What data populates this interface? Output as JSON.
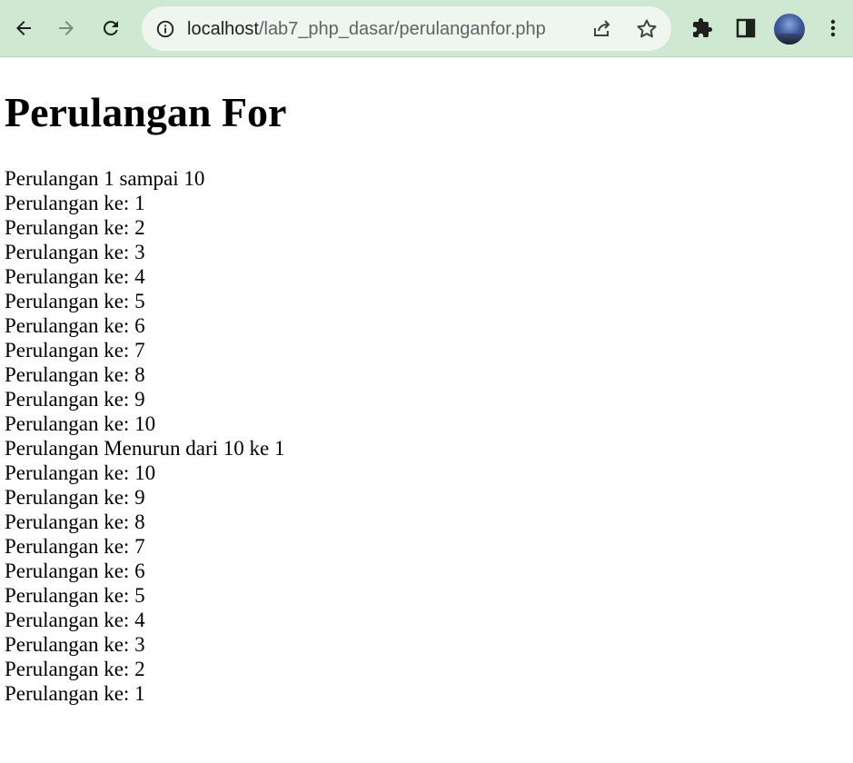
{
  "browser": {
    "url_host": "localhost",
    "url_path": "/lab7_php_dasar/perulanganfor.php",
    "theme_color": "#cfe8d1"
  },
  "page": {
    "title": "Perulangan For",
    "lines": [
      "Perulangan 1 sampai 10",
      "Perulangan ke: 1",
      "Perulangan ke: 2",
      "Perulangan ke: 3",
      "Perulangan ke: 4",
      "Perulangan ke: 5",
      "Perulangan ke: 6",
      "Perulangan ke: 7",
      "Perulangan ke: 8",
      "Perulangan ke: 9",
      "Perulangan ke: 10",
      "Perulangan Menurun dari 10 ke 1",
      "Perulangan ke: 10",
      "Perulangan ke: 9",
      "Perulangan ke: 8",
      "Perulangan ke: 7",
      "Perulangan ke: 6",
      "Perulangan ke: 5",
      "Perulangan ke: 4",
      "Perulangan ke: 3",
      "Perulangan ke: 2",
      "Perulangan ke: 1"
    ]
  }
}
